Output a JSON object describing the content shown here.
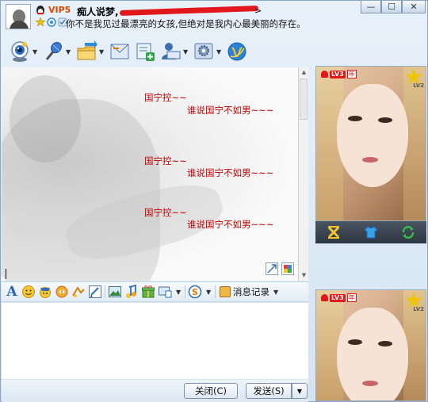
{
  "header": {
    "vip_label": "VIP5",
    "nickname": "痴人说梦,",
    "redacted_tail": ">",
    "signature": "你不是我见过最漂亮的女孩,但绝对是我内心最美丽的存在。"
  },
  "window_controls": {
    "minimize": "—",
    "maximize": "☐",
    "close": "✕"
  },
  "toolbar": {
    "items": [
      {
        "name": "video-call",
        "icon": "webcam-icon"
      },
      {
        "name": "voice-call",
        "icon": "microphone-icon"
      },
      {
        "name": "send-file",
        "icon": "folder-arrow-icon"
      },
      {
        "name": "send-email",
        "icon": "envelope-icon"
      },
      {
        "name": "create-group",
        "icon": "add-contact-icon"
      },
      {
        "name": "remote-assist",
        "icon": "remote-user-icon"
      },
      {
        "name": "app-settings",
        "icon": "gear-icon"
      },
      {
        "name": "qq-zone",
        "icon": "globe-icon"
      }
    ]
  },
  "chat": {
    "messages": [
      {
        "text": "国宁控~~"
      },
      {
        "text": "谁说国宁不如男~~~"
      },
      {
        "text": "国宁控~~"
      },
      {
        "text": "谁说国宁不如男~~~"
      },
      {
        "text": "国宁控~~"
      },
      {
        "text": "谁说国宁不如男~~~"
      }
    ]
  },
  "format_bar": {
    "font_label": "A",
    "record_label": "消息记录"
  },
  "buttons": {
    "close": "关闭(C)",
    "send": "发送(S)",
    "send_dropdown": "▼"
  },
  "profile": {
    "level": "LV3",
    "year_badge": "年",
    "star_level": "LV2"
  },
  "colors": {
    "message_red": "#c00000",
    "accent_blue": "#2a62b4",
    "vip_orange": "#d84a00"
  }
}
